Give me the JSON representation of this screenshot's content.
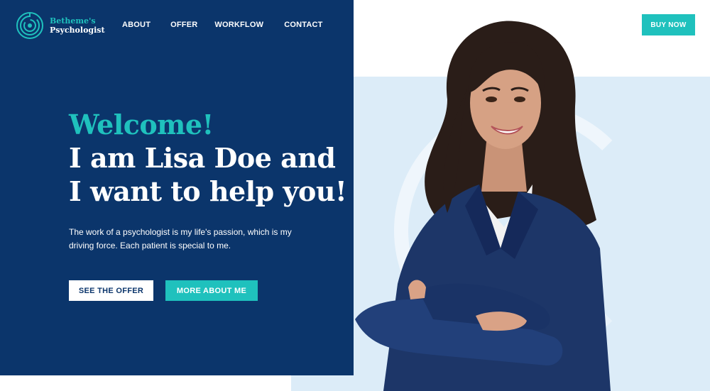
{
  "brand": {
    "line1": "Betheme's",
    "line2": "Psychologist",
    "accent_color": "#1fc1bd",
    "navy_color": "#0b356b"
  },
  "nav": {
    "items": [
      {
        "label": "ABOUT"
      },
      {
        "label": "OFFER"
      },
      {
        "label": "WORKFLOW"
      },
      {
        "label": "CONTACT"
      }
    ]
  },
  "header": {
    "buy_label": "BUY NOW"
  },
  "hero": {
    "welcome": "Welcome!",
    "title_line1": "I am Lisa Doe and",
    "title_line2": "I want to help you!",
    "description": "The work of a psychologist is my life's passion, which is my driving force. Each patient is special to me.",
    "primary_button": "SEE THE OFFER",
    "secondary_button": "MORE ABOUT ME"
  },
  "portrait": {
    "subject": "smiling woman in navy blazer with arms crossed"
  }
}
